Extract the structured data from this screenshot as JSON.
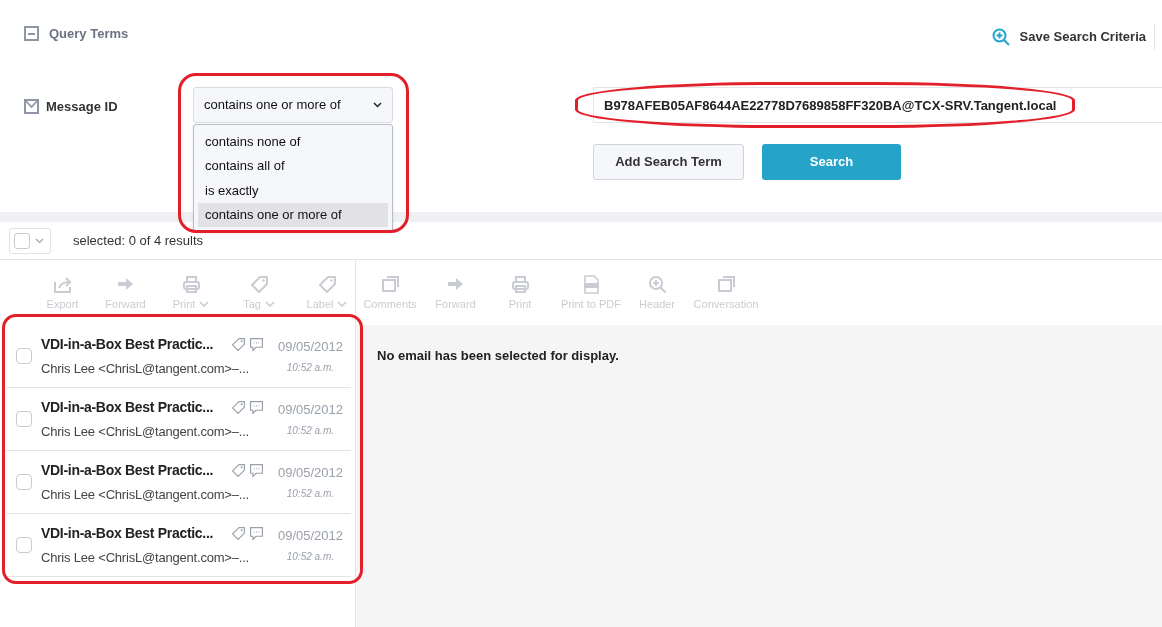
{
  "query_terms": {
    "title": "Query Terms",
    "expanded": true
  },
  "save_search": {
    "label": "Save Search Criteria"
  },
  "term": {
    "field": "Message ID",
    "checked": true,
    "operator": "contains one or more of",
    "options": [
      {
        "label": "contains none of",
        "selected": false
      },
      {
        "label": "contains all of",
        "selected": false
      },
      {
        "label": "is exactly",
        "selected": false
      },
      {
        "label": "contains one or more of",
        "selected": true
      }
    ],
    "value": "B978AFEB05AF8644AE22778D7689858FF320BA@TCX-SRV.Tangent.local"
  },
  "buttons": [
    {
      "label": "Add Search Term",
      "kind": "secondary"
    },
    {
      "label": "Search",
      "kind": "primary"
    }
  ],
  "selection": {
    "summary": "selected: 0 of 4 results",
    "all_checked": false
  },
  "list_toolbar": [
    {
      "label": "Export",
      "menu": false,
      "disabled": true
    },
    {
      "label": "Forward",
      "menu": false,
      "disabled": true
    },
    {
      "label": "Print",
      "menu": true,
      "disabled": true
    },
    {
      "label": "Tag",
      "menu": true,
      "disabled": true
    },
    {
      "label": "Label",
      "menu": true,
      "disabled": true
    }
  ],
  "emails": [
    {
      "subject": "VDI-in-a-Box Best Practic...",
      "sender": "Chris Lee <ChrisL@tangent.com>–...",
      "date": "09/05/2012",
      "time": "10:52 a.m.",
      "checked": false
    },
    {
      "subject": "VDI-in-a-Box Best Practic...",
      "sender": "Chris Lee <ChrisL@tangent.com>–...",
      "date": "09/05/2012",
      "time": "10:52 a.m.",
      "checked": false
    },
    {
      "subject": "VDI-in-a-Box Best Practic...",
      "sender": "Chris Lee <ChrisL@tangent.com>–...",
      "date": "09/05/2012",
      "time": "10:52 a.m.",
      "checked": false
    },
    {
      "subject": "VDI-in-a-Box Best Practic...",
      "sender": "Chris Lee <ChrisL@tangent.com>–...",
      "date": "09/05/2012",
      "time": "10:52 a.m.",
      "checked": false
    }
  ],
  "reader_toolbar": [
    {
      "label": "Comments",
      "disabled": true
    },
    {
      "label": "Forward",
      "disabled": true
    },
    {
      "label": "Print",
      "disabled": true
    },
    {
      "label": "Print to PDF",
      "disabled": true
    },
    {
      "label": "Header",
      "disabled": true
    },
    {
      "label": "Conversation",
      "disabled": true
    }
  ],
  "reader": {
    "message": "No email has been selected for display."
  }
}
